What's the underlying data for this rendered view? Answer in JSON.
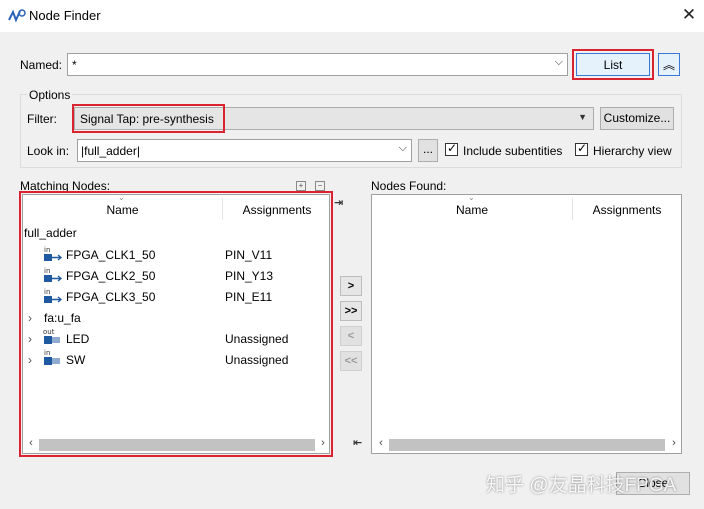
{
  "window": {
    "title": "Node Finder",
    "close_glyph": "✕"
  },
  "named": {
    "label": "Named:",
    "value": "*"
  },
  "list_button": {
    "label": "List"
  },
  "collapse_button": {
    "glyph": "︽"
  },
  "options": {
    "label": "Options"
  },
  "filter": {
    "label": "Filter:",
    "value": "Signal Tap: pre-synthesis"
  },
  "customize_button": {
    "label": "Customize..."
  },
  "lookin": {
    "label": "Look in:",
    "value": "|full_adder|",
    "browse_label": "..."
  },
  "include_subentities": {
    "label": "Include subentities",
    "checked": true
  },
  "hierarchy_view": {
    "label": "Hierarchy view",
    "checked": true
  },
  "matching": {
    "label": "Matching Nodes:",
    "columns": [
      "Name",
      "Assignments"
    ],
    "root": "full_adder",
    "rows": [
      {
        "name": "FPGA_CLK1_50",
        "assignment": "PIN_V11",
        "dir": "in",
        "expandable": false
      },
      {
        "name": "FPGA_CLK2_50",
        "assignment": "PIN_Y13",
        "dir": "in",
        "expandable": false
      },
      {
        "name": "FPGA_CLK3_50",
        "assignment": "PIN_E11",
        "dir": "in",
        "expandable": false
      },
      {
        "name": "fa:u_fa",
        "assignment": "",
        "dir": "",
        "expandable": true
      },
      {
        "name": "LED",
        "assignment": "Unassigned",
        "dir": "out",
        "expandable": true
      },
      {
        "name": "SW",
        "assignment": "Unassigned",
        "dir": "in",
        "expandable": true
      }
    ]
  },
  "transfer_buttons": [
    ">",
    ">>",
    "<",
    "<<"
  ],
  "found": {
    "label": "Nodes Found:",
    "columns": [
      "Name",
      "Assignments"
    ]
  },
  "close_button": {
    "label": "Close"
  },
  "watermark": "知乎 @友晶科技FPGA",
  "colors": {
    "highlight_border": "#d9232e",
    "pin_icon": "#1f5aa0"
  }
}
